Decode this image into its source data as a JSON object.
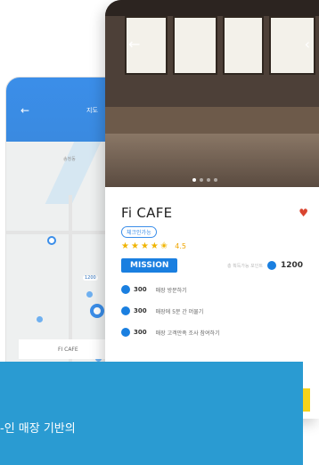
{
  "map_phone": {
    "title": "지도",
    "back_icon": "arrow-left-icon",
    "labels": [
      "송정동",
      "1200"
    ],
    "bottom_label": "FI CAFE"
  },
  "shop": {
    "name": "Fi CAFE",
    "tag": "체크인가능",
    "rating": "4.5",
    "stars": 4.5,
    "mission_label": "MISSION",
    "mission_note": "총 획득가능 포인트",
    "mission_points": "1200",
    "tasks": [
      {
        "points": "300",
        "desc": "매장 방문하기"
      },
      {
        "points": "300",
        "desc": "매장에 5분 간 머물기"
      },
      {
        "points": "300",
        "desc": "매장 고객만족 조사 참여하기"
      }
    ],
    "heart_icon": "heart-icon",
    "colors": {
      "accent": "#1a7fe0",
      "heart": "#d9442f",
      "star": "#f0b400",
      "banner": "#2a9bd2"
    }
  },
  "banner": {
    "text": "-인 매장 기반의"
  }
}
